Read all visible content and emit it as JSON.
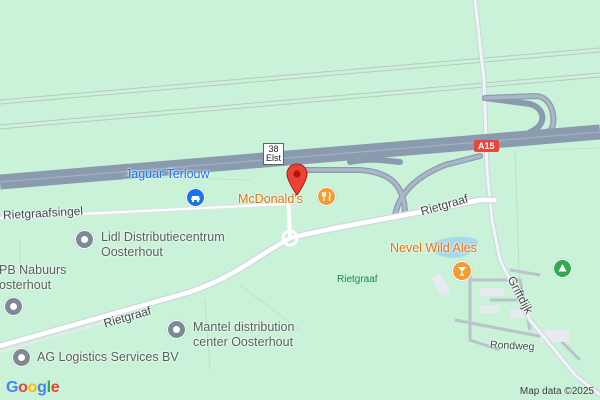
{
  "roads": {
    "a15": "A15",
    "exit_number": "38",
    "exit_name": "Elst",
    "rietgraafsingel": "Rietgraafsingel",
    "rietgraaf_east": "Rietgraaf",
    "rietgraaf_west": "Rietgraaf",
    "griftdijk": "Griftdijk",
    "rondweg": "Rondweg"
  },
  "places": {
    "jaguar": "Jaguar Terlouw",
    "mcdonalds": "McDonald's",
    "nevel": "Nevel Wild Ales",
    "lidl_line1": "Lidl Distributiecentrum",
    "lidl_line2": "Oosterhout",
    "pb_line1": "PB Nabuurs",
    "pb_line2": "osterhout",
    "mantel_line1": "Mantel distribution",
    "mantel_line2": "center Oosterhout",
    "ag": "AG Logistics Services BV",
    "area": "Rietgraaf"
  },
  "icons": {
    "jaguar": "car-dealer-icon",
    "mcdonalds": "restaurant-icon",
    "nevel": "bar-icon",
    "business": "business-icon",
    "park": "park-icon",
    "pin": "location-pin-icon"
  },
  "colors": {
    "land": "#c9f2d9",
    "highway": "#8a9bb0",
    "restaurant": "#f29d33",
    "business": "#7b8a94",
    "car_dealer": "#1a73e8",
    "park": "#34a853",
    "pin": "#ea4335"
  },
  "attribution": {
    "logo": "Google",
    "copyright": "Map data ©2025"
  }
}
